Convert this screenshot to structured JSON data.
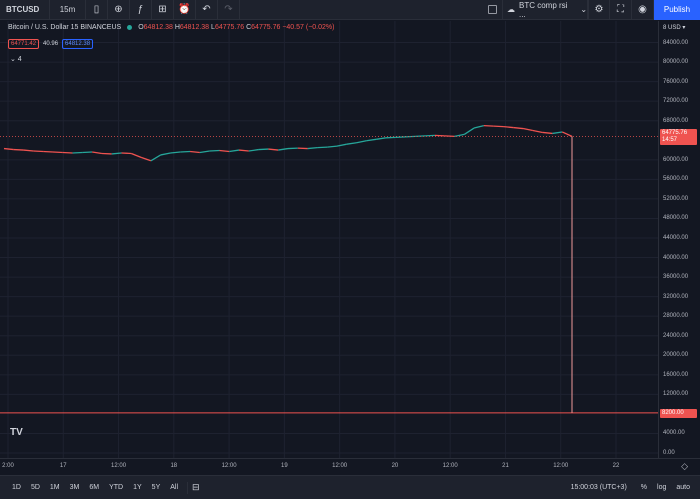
{
  "toolbar": {
    "symbol": "BTCUSD",
    "interval": "15m",
    "layout_name": "BTC comp rsi ...",
    "publish_label": "Publish",
    "icons": [
      "candles-icon",
      "plus-circle-icon",
      "indicators-icon",
      "templates-icon",
      "alert-icon",
      "undo-icon",
      "redo-icon",
      "cloud-icon",
      "chevron-down-icon",
      "gear-icon",
      "fullscreen-icon",
      "camera-icon"
    ]
  },
  "legend": {
    "title": "Bitcoin / U.S. Dollar  15  BINANCEUS",
    "open_label": "O",
    "open": "64812.38",
    "high_label": "H",
    "high": "64812.38",
    "low_label": "L",
    "low": "64775.76",
    "close_label": "C",
    "close": "64775.76",
    "change": "−40.57 (−0.02%)",
    "bid": "64771.42",
    "spread": "40.96",
    "ask": "64812.38",
    "collapse": "⌄ 4"
  },
  "price_scale": {
    "currency": "USD ▾",
    "currency_prefix": "8",
    "ticks": [
      "84000.00",
      "80000.00",
      "76000.00",
      "72000.00",
      "68000.00",
      "60000.00",
      "56000.00",
      "52000.00",
      "48000.00",
      "44000.00",
      "40000.00",
      "36000.00",
      "32000.00",
      "28000.00",
      "24000.00",
      "20000.00",
      "16000.00",
      "12000.00",
      "4000.00",
      "0.00"
    ],
    "current_price": "64775.76",
    "countdown": "14:57",
    "level_price": "8200.00"
  },
  "time_axis": {
    "labels": [
      "2:00",
      "17",
      "12:00",
      "18",
      "12:00",
      "19",
      "12:00",
      "20",
      "12:00",
      "21",
      "12:00",
      "22"
    ]
  },
  "bottom_bar": {
    "ranges": [
      "1D",
      "5D",
      "1M",
      "3M",
      "6M",
      "YTD",
      "1Y",
      "5Y",
      "All"
    ],
    "time": "15:00:03 (UTC+3)",
    "percent": "%",
    "log": "log",
    "auto": "auto"
  },
  "chart_data": {
    "type": "line",
    "x": [
      0,
      1,
      2,
      3,
      4,
      5,
      6,
      7,
      8,
      9,
      10,
      11,
      12,
      13,
      14,
      15,
      16,
      17,
      18,
      19,
      20,
      21,
      22,
      23,
      24,
      25,
      26,
      27,
      28,
      29,
      30,
      31,
      32,
      33,
      34,
      35,
      36,
      37,
      38,
      39,
      40,
      41,
      42,
      43,
      44,
      45,
      46,
      47,
      48,
      49,
      50,
      51,
      52,
      53,
      54,
      55,
      56,
      57,
      58
    ],
    "series": [
      {
        "values": [
          62300,
          62100,
          62000,
          61800,
          61700,
          61600,
          61500,
          61400,
          61500,
          61600,
          61300,
          61200,
          61400,
          61300,
          60500,
          59800,
          61000,
          61400,
          61600,
          61700,
          61500,
          61800,
          61900,
          61700,
          62000,
          61800,
          62100,
          62200,
          62000,
          62300,
          62400,
          62300,
          62500,
          62600,
          62800,
          63200,
          63500,
          63900,
          64200,
          64500,
          64600,
          64700,
          64800,
          64900,
          65000,
          64900,
          64800,
          65200,
          66500,
          67000,
          66900,
          66800,
          66600,
          66400,
          66000,
          65600,
          65400,
          65700,
          64800
        ]
      }
    ],
    "ylim": [
      0,
      88000
    ],
    "grid": true,
    "hline": 8200,
    "colors": {
      "up": "#26a69a",
      "down": "#ef5350",
      "hline": "#ef5350"
    }
  }
}
